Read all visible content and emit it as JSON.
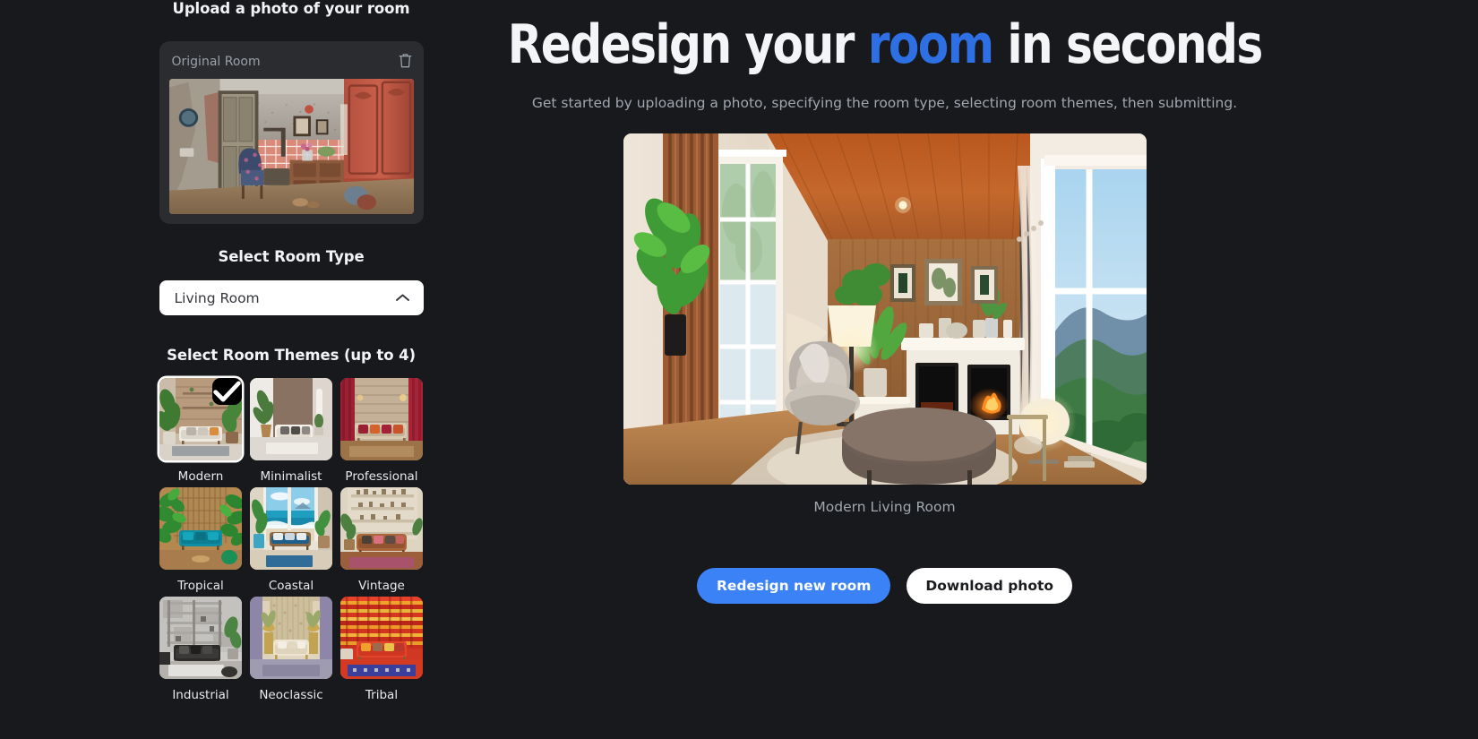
{
  "theme_colors": {
    "background": "#17191d",
    "card": "#2a2c30",
    "accent_blue": "#2f6fe4",
    "button_blue": "#3b82f6",
    "text_primary": "#f2f3f5",
    "text_muted": "#a2a7ae"
  },
  "sidebar": {
    "upload_title": "Upload a photo of your room",
    "original_label": "Original Room",
    "delete_icon": "trash-icon",
    "room_type_title": "Select Room Type",
    "room_type_value": "Living Room",
    "room_type_chevron": "chevron-up-icon",
    "themes_title": "Select Room Themes (up to 4)",
    "themes": [
      {
        "label": "Modern",
        "selected": true
      },
      {
        "label": "Minimalist",
        "selected": false
      },
      {
        "label": "Professional",
        "selected": false
      },
      {
        "label": "Tropical",
        "selected": false
      },
      {
        "label": "Coastal",
        "selected": false
      },
      {
        "label": "Vintage",
        "selected": false
      },
      {
        "label": "Industrial",
        "selected": false
      },
      {
        "label": "Neoclassic",
        "selected": false
      },
      {
        "label": "Tribal",
        "selected": false
      }
    ],
    "check_icon": "check-icon"
  },
  "main": {
    "headline_part1": "Redesign your ",
    "headline_accent": "room",
    "headline_part2": " in seconds",
    "subheadline": "Get started by uploading a photo, specifying the room type, selecting room themes, then submitting.",
    "result_caption": "Modern Living Room",
    "primary_button": "Redesign new room",
    "secondary_button": "Download photo"
  }
}
